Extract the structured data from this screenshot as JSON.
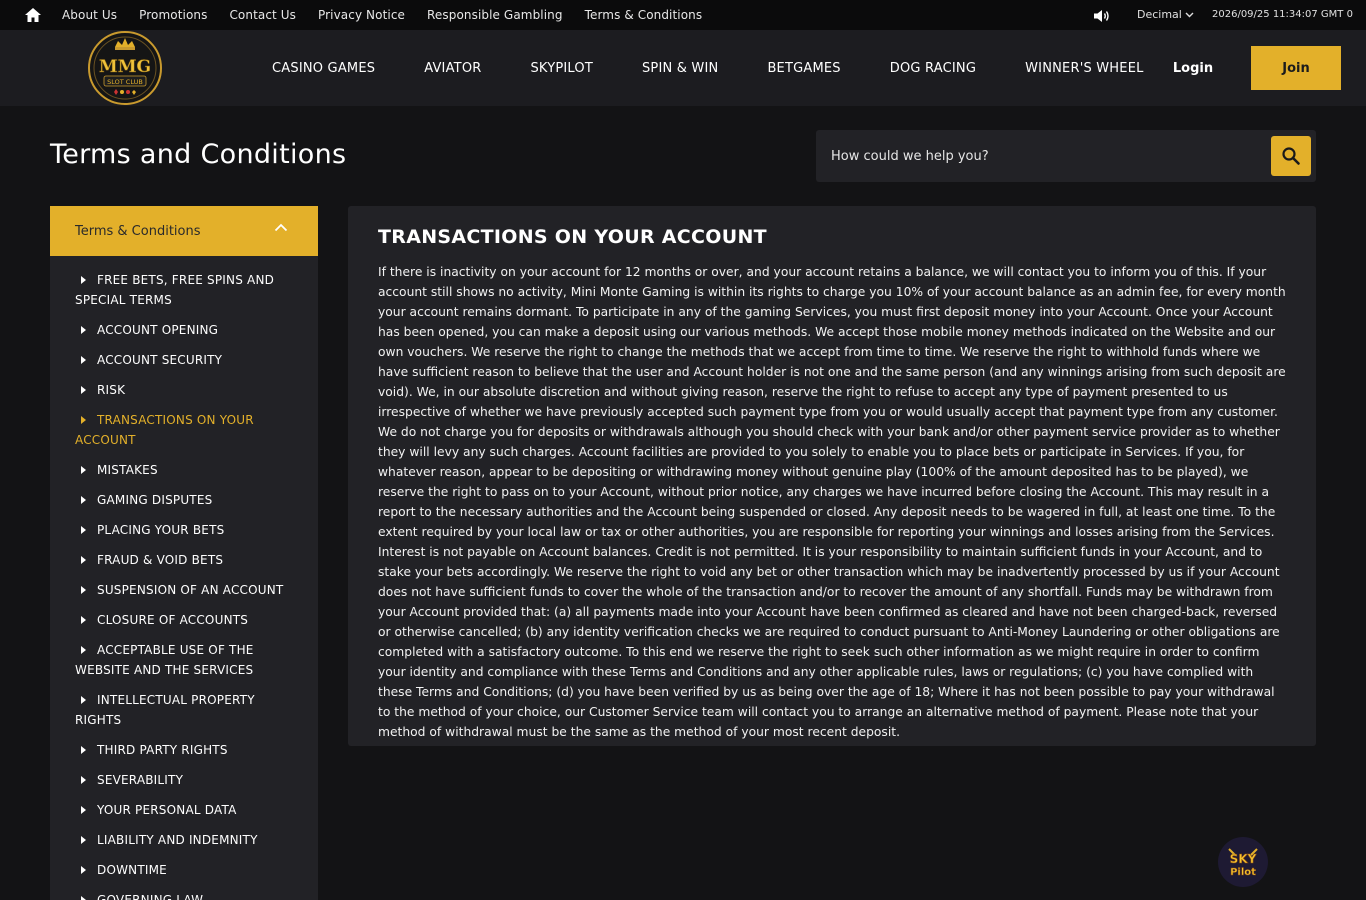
{
  "topbar": {
    "links": [
      "About Us",
      "Promotions",
      "Contact Us",
      "Privacy Notice",
      "Responsible Gambling",
      "Terms & Conditions"
    ],
    "odds_format": "Decimal",
    "datetime": "2026/09/25  11:34:07 GMT 0"
  },
  "header": {
    "logo_text": "MMG",
    "logo_subtext": "SLOT CLUB",
    "nav": [
      "CASINO GAMES",
      "AVIATOR",
      "SKYPILOT",
      "SPIN & WIN",
      "BETGAMES",
      "DOG RACING",
      "WINNER'S WHEEL"
    ],
    "login_label": "Login",
    "join_label": "Join"
  },
  "page": {
    "title": "Terms and Conditions"
  },
  "search": {
    "placeholder": "How could we help you?"
  },
  "sidebar": {
    "heading": "Terms & Conditions",
    "items": [
      {
        "label": "FREE BETS, FREE SPINS AND SPECIAL TERMS",
        "active": false
      },
      {
        "label": "ACCOUNT OPENING",
        "active": false
      },
      {
        "label": "ACCOUNT SECURITY",
        "active": false
      },
      {
        "label": "RISK",
        "active": false
      },
      {
        "label": "TRANSACTIONS ON YOUR ACCOUNT",
        "active": true
      },
      {
        "label": "MISTAKES",
        "active": false
      },
      {
        "label": "GAMING DISPUTES",
        "active": false
      },
      {
        "label": "PLACING YOUR BETS",
        "active": false
      },
      {
        "label": "FRAUD & VOID BETS",
        "active": false
      },
      {
        "label": "SUSPENSION OF AN ACCOUNT",
        "active": false
      },
      {
        "label": "CLOSURE OF ACCOUNTS",
        "active": false
      },
      {
        "label": "ACCEPTABLE USE OF THE WEBSITE AND THE SERVICES",
        "active": false
      },
      {
        "label": "INTELLECTUAL PROPERTY RIGHTS",
        "active": false
      },
      {
        "label": "THIRD PARTY RIGHTS",
        "active": false
      },
      {
        "label": "SEVERABILITY",
        "active": false
      },
      {
        "label": "YOUR PERSONAL DATA",
        "active": false
      },
      {
        "label": "LIABILITY AND INDEMNITY",
        "active": false
      },
      {
        "label": "DOWNTIME",
        "active": false
      },
      {
        "label": "GOVERNING LAW",
        "active": false
      }
    ]
  },
  "article": {
    "heading": "TRANSACTIONS ON YOUR ACCOUNT",
    "body": "If there is inactivity on your account for 12 months or over, and your account retains a balance, we will contact you to inform you of this. If your account still shows no activity, Mini Monte Gaming is within its rights to charge you 10% of your account balance as an admin fee, for every month your account remains dormant. To participate in any of the gaming Services, you must first deposit money into your Account. Once your Account has been opened, you can make a deposit using our various methods. We accept those mobile money methods indicated on the Website and our own vouchers. We reserve the right to change the methods that we accept from time to time. We reserve the right to withhold funds where we have sufficient reason to believe that the user and Account holder is not one and the same person (and any winnings arising from such deposit are void). We, in our absolute discretion and without giving reason, reserve the right to refuse to accept any type of payment presented to us irrespective of whether we have previously accepted such payment type from you or would usually accept that payment type from any customer. We do not charge you for deposits or withdrawals although you should check with your bank and/or other payment service provider as to whether they will levy any such charges. Account facilities are provided to you solely to enable you to place bets or participate in Services. If you, for whatever reason, appear to be depositing or withdrawing money without genuine play (100% of the amount deposited has to be played), we reserve the right to pass on to your Account, without prior notice, any charges we have incurred before closing the Account. This may result in a report to the necessary authorities and the Account being suspended or closed. Any deposit needs to be wagered in full, at least one time. To the extent required by your local law or tax or other authorities, you are responsible for reporting your winnings and losses arising from the Services. Interest is not payable on Account balances. Credit is not permitted. It is your responsibility to maintain sufficient funds in your Account, and to stake your bets accordingly. We reserve the right to void any bet or other transaction which may be inadvertently processed by us if your Account does not have sufficient funds to cover the whole of the transaction and/or to recover the amount of any shortfall. Funds may be withdrawn from your Account provided that: (a) all payments made into your Account have been confirmed as cleared and have not been charged-back, reversed or otherwise cancelled; (b) any identity verification checks we are required to conduct pursuant to Anti-Money Laundering or other obligations are completed with a satisfactory outcome. To this end we reserve the right to seek such other information as we might require in order to confirm your identity and compliance with these Terms and Conditions and any other applicable rules, laws or regulations; (c) you have complied with these Terms and Conditions; (d) you have been verified by us as being over the age of 18; Where it has not been possible to pay your withdrawal to the method of your choice, our Customer Service team will contact you to arrange an alternative method of payment. Please note that your method of withdrawal must be the same as the method of your most recent deposit."
  },
  "badge": {
    "text": "SKY Pilot"
  },
  "colors": {
    "accent": "#e3b02a",
    "background": "#131315",
    "panel": "#222226",
    "header": "#1c1c20",
    "topbar": "#0b0b0c"
  },
  "icons": [
    "home-icon",
    "speaker-icon",
    "chevron-down-icon",
    "search-icon",
    "chevron-up-icon",
    "caret-right-icon"
  ]
}
